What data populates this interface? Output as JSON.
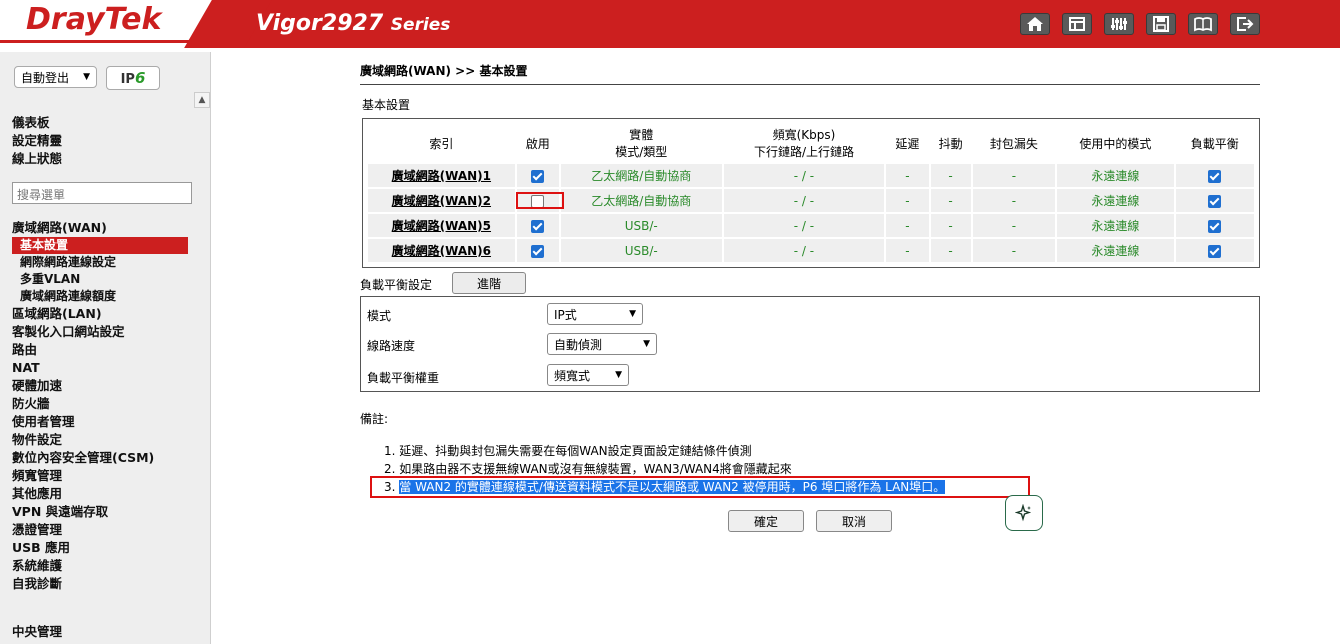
{
  "header": {
    "brand": "DrayTek",
    "model": "Vigor2927",
    "series": "Series",
    "icons": [
      "home-icon",
      "layout-icon",
      "sliders-icon",
      "save-icon",
      "book-icon",
      "logout-icon"
    ]
  },
  "sidebar": {
    "logout_select": "自動登出",
    "ipv6": "IPv6",
    "top_items": [
      "儀表板",
      "設定精靈",
      "線上狀態"
    ],
    "search_placeholder": "搜尋選單",
    "wan_group": "廣域網路(WAN)",
    "wan_sub": [
      "基本設置",
      "網際網路連線設定",
      "多重VLAN",
      "廣域網路連線額度"
    ],
    "items": [
      "區域網路(LAN)",
      "客製化入口網站設定",
      "路由",
      "NAT",
      "硬體加速",
      "防火牆",
      "使用者管理",
      "物件設定",
      "數位內容安全管理(CSM)",
      "頻寬管理",
      "其他應用",
      "VPN 與遠端存取",
      "憑證管理",
      "USB 應用",
      "系統維護",
      "自我診斷"
    ],
    "bottom_item": "中央管理"
  },
  "main": {
    "breadcrumb": "廣域網路(WAN) >> 基本設置",
    "section_title": "基本設置",
    "table": {
      "headers": [
        "索引",
        "啟用",
        "實體\n模式/類型",
        "頻寬(Kbps)\n下行鏈路/上行鏈路",
        "延遲",
        "抖動",
        "封包漏失",
        "使用中的模式",
        "負載平衡"
      ],
      "rows": [
        {
          "index": "廣域網路(WAN)1",
          "enabled": true,
          "type": "乙太網路/自動協商",
          "bw": "- / -",
          "lat": "-",
          "jit": "-",
          "loss": "-",
          "mode": "永遠連線",
          "lb": true
        },
        {
          "index": "廣域網路(WAN)2",
          "enabled": false,
          "type": "乙太網路/自動協商",
          "bw": "- / -",
          "lat": "-",
          "jit": "-",
          "loss": "-",
          "mode": "永遠連線",
          "lb": true
        },
        {
          "index": "廣域網路(WAN)5",
          "enabled": true,
          "type": "USB/-",
          "bw": "- / -",
          "lat": "-",
          "jit": "-",
          "loss": "-",
          "mode": "永遠連線",
          "lb": true
        },
        {
          "index": "廣域網路(WAN)6",
          "enabled": true,
          "type": "USB/-",
          "bw": "- / -",
          "lat": "-",
          "jit": "-",
          "loss": "-",
          "mode": "永遠連線",
          "lb": true
        }
      ]
    },
    "lb": {
      "title": "負載平衡設定",
      "advanced": "進階",
      "mode_label": "模式",
      "mode_value": "IP式",
      "speed_label": "線路速度",
      "speed_value": "自動偵測",
      "weight_label": "負載平衡權重",
      "weight_value": "頻寬式"
    },
    "notes_title": "備註:",
    "notes": [
      "1. 延遲、抖動與封包漏失需要在每個WAN設定頁面設定鏈結條件偵測",
      "2. 如果路由器不支援無線WAN或沒有無線裝置，WAN3/WAN4將會隱藏起來"
    ],
    "note3_prefix": "3. ",
    "note3_text": "當 WAN2 的實體連線模式/傳送資料模式不是以太網路或 WAN2 被停用時，P6 埠口將作為 LAN埠口。",
    "ok": "確定",
    "cancel": "取消"
  },
  "colors": {
    "brand_red": "#cc1f1f",
    "status_green": "#2a8a2a",
    "checkbox_blue": "#1f6fd0"
  }
}
